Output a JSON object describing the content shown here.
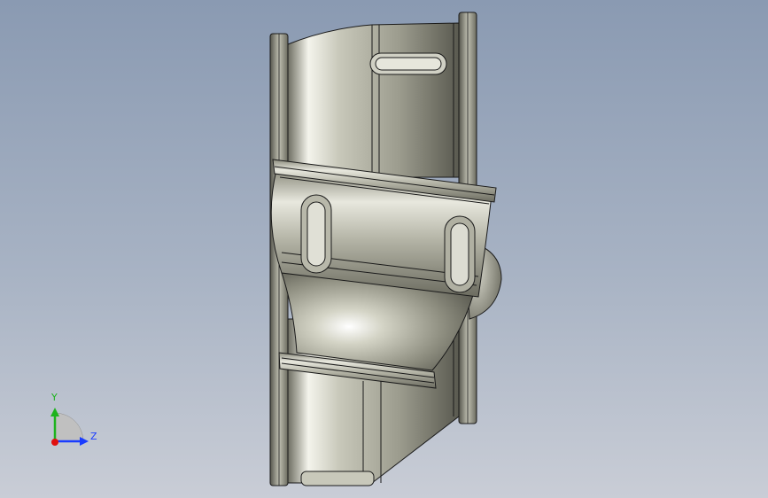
{
  "viewport": {
    "background_top": "#8a9ab2",
    "background_bottom": "#c9cdd6"
  },
  "model": {
    "icon": "pipe-fitting-model",
    "metal_color": "#b8b8a8",
    "edge_color": "#1a1a1a"
  },
  "triad": {
    "y_label": "Y",
    "z_label": "Z",
    "y_color": "#1db31d",
    "z_color": "#1a3cff",
    "x_color": "#e01010"
  }
}
